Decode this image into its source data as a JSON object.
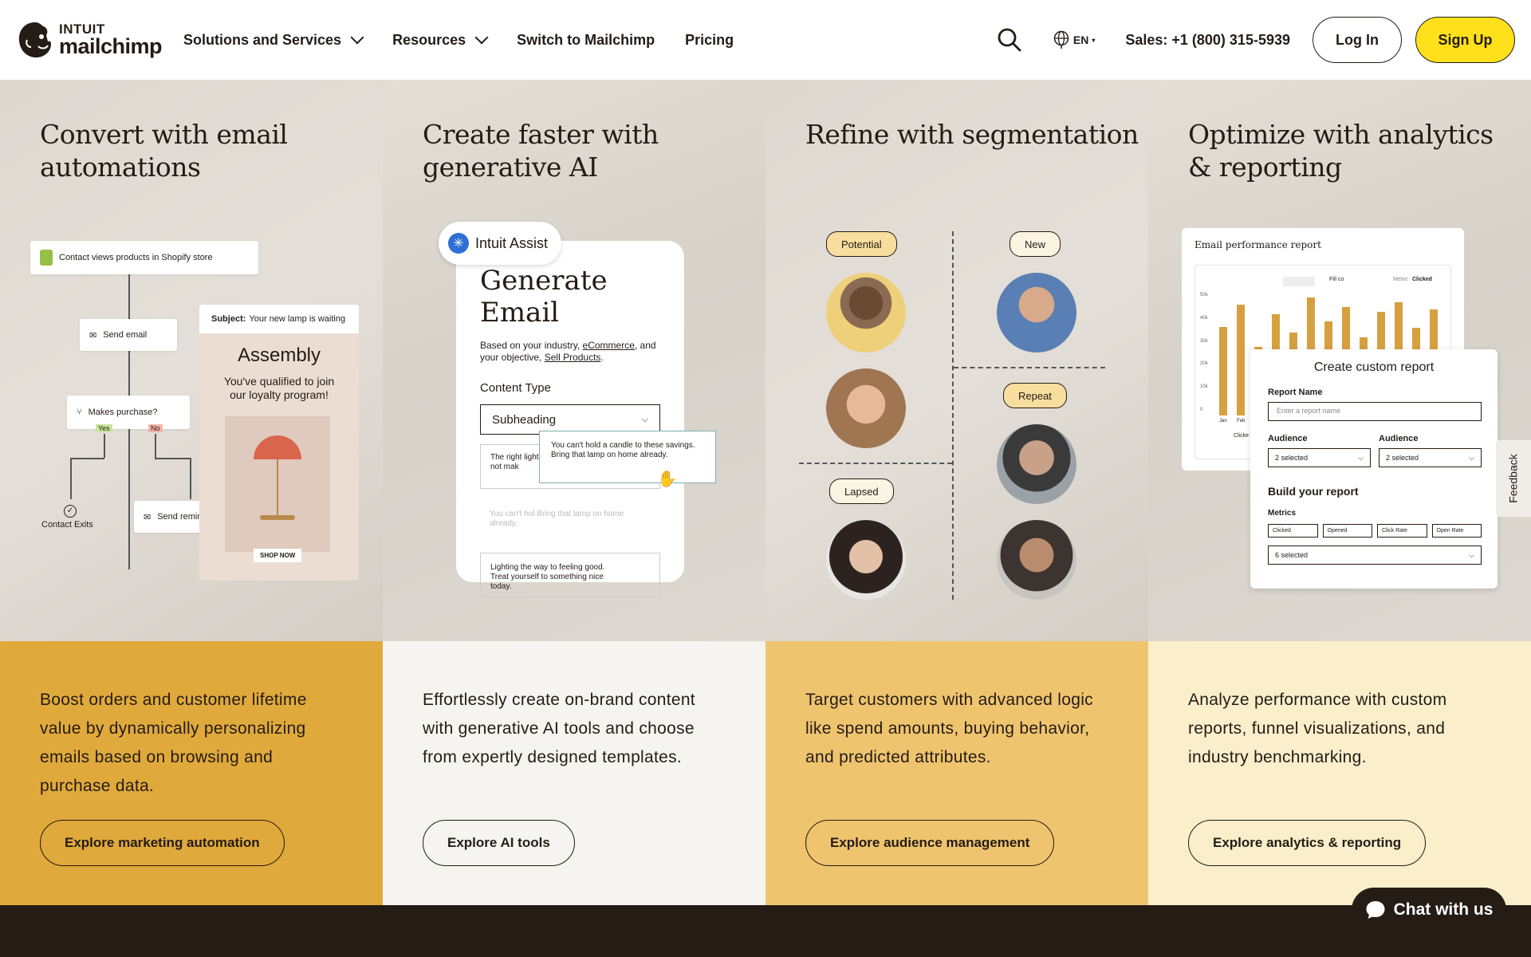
{
  "header": {
    "logo_top": "INTUIT",
    "logo_bottom": "mailchimp",
    "nav": [
      {
        "label": "Solutions and Services"
      },
      {
        "label": "Resources"
      },
      {
        "label": "Switch to Mailchimp"
      },
      {
        "label": "Pricing"
      }
    ],
    "language": "EN",
    "sales": "Sales: +1 (800) 315-5939",
    "login": "Log In",
    "signup": "Sign Up"
  },
  "columns": [
    {
      "title": "Convert with email automations",
      "description": "Boost orders and customer lifetime value by dynamically personalizing emails based on browsing and purchase data.",
      "cta": "Explore marketing automation",
      "mock": {
        "trigger": "Contact views products in Shopify store",
        "send_email": "Send email",
        "decision": "Makes purchase?",
        "yes": "Yes",
        "no": "No",
        "exit": "Contact Exits",
        "reminder": "Send reminder",
        "subject_label": "Subject:",
        "subject": "Your new lamp is waiting",
        "email_title": "Assembly",
        "email_body": "You've qualified to join our loyalty program!",
        "shop": "SHOP NOW"
      }
    },
    {
      "title": "Create faster with generative AI",
      "description": "Effortlessly create on-brand content with generative AI tools and choose from expertly designed templates.",
      "cta": "Explore AI tools",
      "mock": {
        "assist": "Intuit Assist",
        "heading": "Generate Email",
        "based_pre": "Based on your industry, ",
        "industry": "eCommerce",
        "based_mid": ", and your objective, ",
        "objective": "Sell Products",
        "based_post": ".",
        "content_type": "Content Type",
        "select": "Subheading",
        "opt1": "The right light really makes a difference. Why not mak",
        "opt2": "You can't hold a candle to these savings. Bring that lamp on home already.",
        "opt2_ghost": "You can't hol Bring that lamp on home already.",
        "opt3": "Lighting the way to feeling good. Treat yourself to something nice today."
      }
    },
    {
      "title": "Refine with segmentation",
      "description": "Target customers with advanced logic like spend amounts, buying behavior, and predicted attributes.",
      "cta": "Explore audience management",
      "mock": {
        "potential": "Potential",
        "new": "New",
        "repeat": "Repeat",
        "lapsed": "Lapsed"
      }
    },
    {
      "title": "Optimize with analytics & reporting",
      "description": "Analyze performance with custom reports, funnel visualizations, and industry benchmarking.",
      "cta": "Explore analytics & reporting",
      "mock": {
        "report_title": "Email performance report",
        "fill": "Fill co",
        "metric_label": "Metric",
        "metric": "Clicked",
        "y_ticks": [
          "50k",
          "40k",
          "30k",
          "20k",
          "10k",
          "0"
        ],
        "x_ticks": [
          "Jan",
          "Feb"
        ],
        "legend": "Clicke",
        "custom_title": "Create custom report",
        "report_name": "Report Name",
        "report_placeholder": "Enter a report name",
        "audience1": "Audience",
        "audience2": "Audience",
        "selected1": "2 selected",
        "selected2": "2 selected",
        "build": "Build your report",
        "metrics": "Metrics",
        "chips": [
          "Clicked",
          "Opened",
          "Click Rate",
          "Open Rate"
        ],
        "six": "6 selected"
      }
    }
  ],
  "feedback": "Feedback",
  "chat": "Chat with us"
}
